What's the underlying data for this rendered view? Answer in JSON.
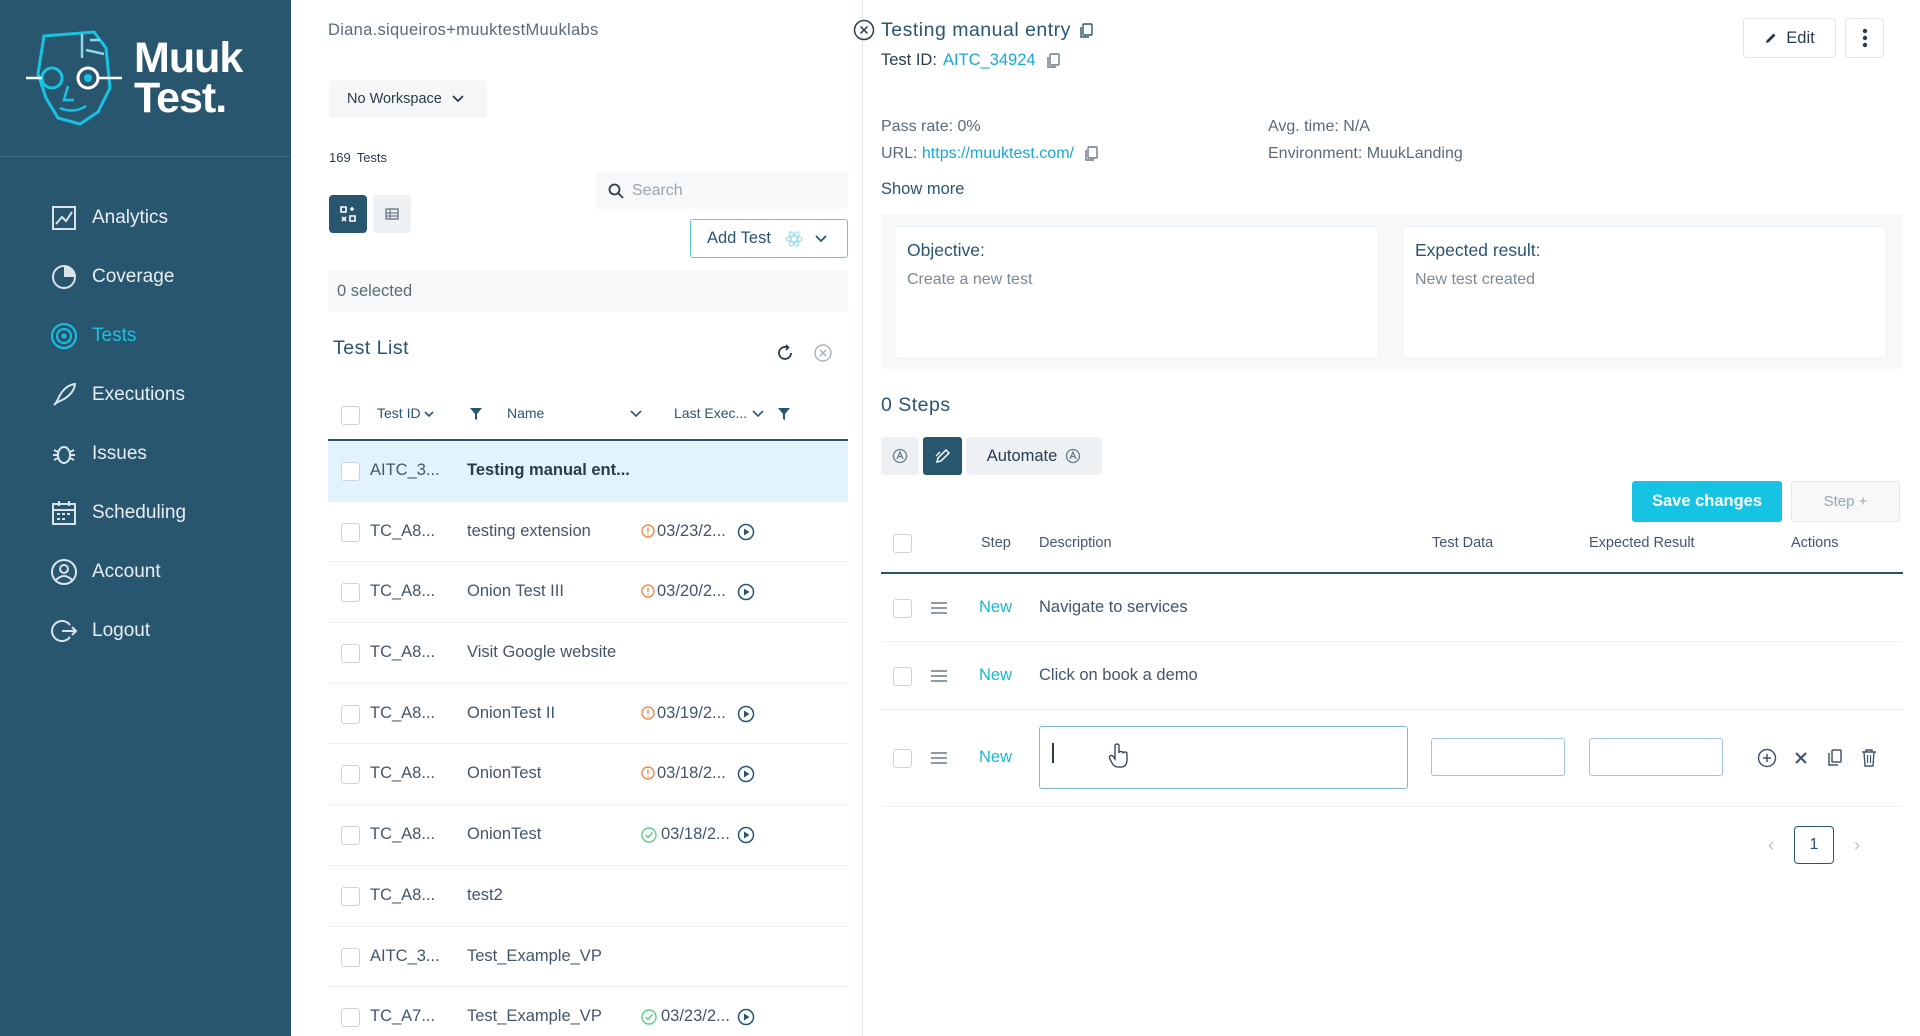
{
  "app": {
    "logo_line1": "Muuk",
    "logo_line2": "Test."
  },
  "sidebar": {
    "items": [
      {
        "label": "Analytics",
        "icon": "chart-icon",
        "active": false
      },
      {
        "label": "Coverage",
        "icon": "pie-icon",
        "active": false
      },
      {
        "label": "Tests",
        "icon": "target-icon",
        "active": true
      },
      {
        "label": "Executions",
        "icon": "rocket-icon",
        "active": false
      },
      {
        "label": "Issues",
        "icon": "bug-icon",
        "active": false
      },
      {
        "label": "Scheduling",
        "icon": "calendar-icon",
        "active": false
      },
      {
        "label": "Account",
        "icon": "user-icon",
        "active": false
      },
      {
        "label": "Logout",
        "icon": "logout-icon",
        "active": false
      }
    ]
  },
  "middle": {
    "user_email": "Diana.siqueiros+muuktestMuuklabs",
    "workspace": "No Workspace",
    "test_count": "169",
    "test_count_label": "Tests",
    "search_placeholder": "Search",
    "add_test": "Add Test",
    "selected": "0 selected",
    "list_title": "Test List",
    "columns": {
      "id": "Test ID",
      "name": "Name",
      "last": "Last Exec..."
    },
    "rows": [
      {
        "id": "AITC_3...",
        "name": "Testing manual ent...",
        "status": "",
        "date": "",
        "selected": true
      },
      {
        "id": "TC_A8...",
        "name": "testing extension",
        "status": "warn",
        "date": "03/23/2...",
        "selected": false
      },
      {
        "id": "TC_A8...",
        "name": "Onion Test III",
        "status": "warn",
        "date": "03/20/2...",
        "selected": false
      },
      {
        "id": "TC_A8...",
        "name": "Visit Google website",
        "status": "",
        "date": "",
        "selected": false
      },
      {
        "id": "TC_A8...",
        "name": "OnionTest II",
        "status": "warn",
        "date": "03/19/2...",
        "selected": false
      },
      {
        "id": "TC_A8...",
        "name": "OnionTest",
        "status": "warn",
        "date": "03/18/2...",
        "selected": false
      },
      {
        "id": "TC_A8...",
        "name": "OnionTest",
        "status": "ok",
        "date": "03/18/2...",
        "selected": false
      },
      {
        "id": "TC_A8...",
        "name": "test2",
        "status": "",
        "date": "",
        "selected": false
      },
      {
        "id": "AITC_3...",
        "name": "Test_Example_VP",
        "status": "",
        "date": "",
        "selected": false
      },
      {
        "id": "TC_A7...",
        "name": "Test_Example_VP",
        "status": "ok",
        "date": "03/23/2...",
        "selected": false
      }
    ]
  },
  "detail": {
    "title": "Testing manual entry",
    "test_id_label": "Test ID:",
    "test_id": "AITC_34924",
    "edit": "Edit",
    "pass_rate": "Pass rate: 0%",
    "url_label": "URL:",
    "url": "https://muuktest.com/",
    "avg_time": "Avg. time: N/A",
    "environment": "Environment: MuukLanding",
    "show_more": "Show more",
    "objective_label": "Objective:",
    "objective": "Create a new test",
    "expected_label": "Expected result:",
    "expected": "New test created",
    "steps_title": "0 Steps",
    "automate": "Automate",
    "save_changes": "Save changes",
    "step_plus": "Step +",
    "step_columns": {
      "step": "Step",
      "description": "Description",
      "test_data": "Test Data",
      "expected": "Expected Result",
      "actions": "Actions"
    },
    "steps": [
      {
        "badge": "New",
        "description": "Navigate to services"
      },
      {
        "badge": "New",
        "description": "Click on book a demo"
      },
      {
        "badge": "New",
        "description": ""
      }
    ],
    "page": "1"
  }
}
